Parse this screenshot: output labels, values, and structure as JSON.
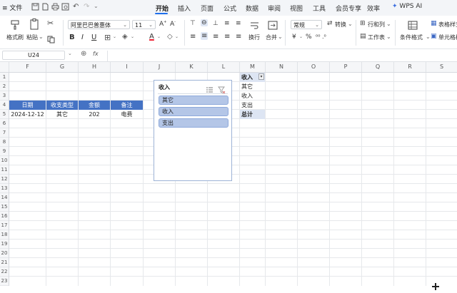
{
  "menu": {
    "file_label": "文件",
    "tabs": [
      "开始",
      "插入",
      "页面",
      "公式",
      "数据",
      "审阅",
      "视图",
      "工具",
      "会员专享",
      "效率"
    ],
    "ai_label": "WPS AI"
  },
  "ribbon": {
    "format_painter": "格式刷",
    "paste": "粘贴",
    "font_name": "阿里巴巴普惠体",
    "font_size": "11",
    "wrap": "换行",
    "merge": "合并",
    "number_format": "常规",
    "convert": "转换",
    "rows_cols": "行和列",
    "worksheet": "工作表",
    "conditional_format": "条件格式",
    "table_style": "表格样式",
    "cell_style": "单元格样式",
    "currency_symbol": "¥",
    "percent_symbol": "%"
  },
  "formula_bar": {
    "name_box": "U24",
    "fx": "fx",
    "value": ""
  },
  "grid": {
    "columns": [
      "F",
      "G",
      "H",
      "I",
      "J",
      "K",
      "L",
      "M",
      "N",
      "O",
      "P",
      "Q",
      "R",
      "S"
    ],
    "rows": [
      "1",
      "2",
      "3",
      "4",
      "5",
      "6",
      "7",
      "8",
      "9",
      "10",
      "11",
      "12",
      "13",
      "14",
      "15",
      "16",
      "17",
      "18",
      "19",
      "20",
      "21",
      "22",
      "23"
    ],
    "table": {
      "headers": [
        "日期",
        "收支类型",
        "金额",
        "备注"
      ],
      "row": [
        "2024-12-12",
        "其它",
        "202",
        "电费"
      ]
    },
    "pivot": {
      "header": "收入",
      "items": [
        "其它",
        "收入",
        "支出"
      ],
      "total": "总计"
    }
  },
  "slicer": {
    "title": "收入",
    "items": [
      "其它",
      "收入",
      "支出"
    ]
  },
  "colors": {
    "header_blue": "#4472c4",
    "slicer_item": "#b4c6e7",
    "active_tab": "#1f6feb"
  }
}
